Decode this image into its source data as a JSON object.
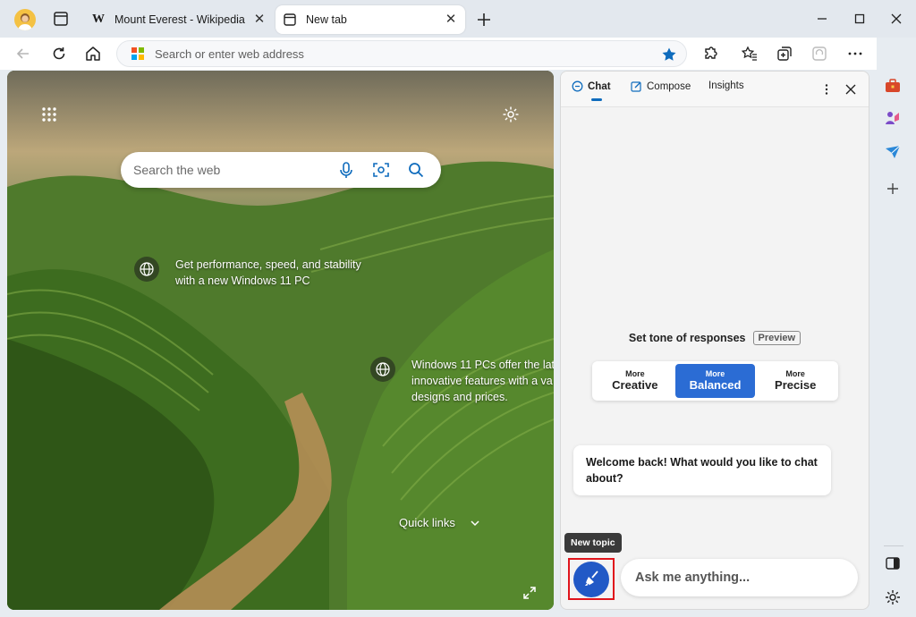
{
  "tabs": [
    {
      "title": "Mount Everest - Wikipedia",
      "favicon": "W"
    },
    {
      "title": "New tab"
    }
  ],
  "address_bar": {
    "placeholder": "Search or enter web address"
  },
  "ntp": {
    "search_placeholder": "Search the web",
    "info_cards": [
      {
        "line1": "Get performance, speed, and stability",
        "line2": "with a new Windows 11 PC"
      },
      {
        "line1": "Windows 11 PCs offer the lat",
        "line2": "innovative features with a va",
        "line3": "designs and prices."
      }
    ],
    "quick_links_label": "Quick links"
  },
  "chat_panel": {
    "tabs": [
      {
        "label": "Chat",
        "active": true
      },
      {
        "label": "Compose",
        "active": false
      },
      {
        "label": "Insights",
        "active": false
      }
    ],
    "tone_title": "Set tone of responses",
    "preview_badge": "Preview",
    "tones": [
      {
        "more": "More",
        "name": "Creative",
        "selected": false
      },
      {
        "more": "More",
        "name": "Balanced",
        "selected": true
      },
      {
        "more": "More",
        "name": "Precise",
        "selected": false
      }
    ],
    "welcome_message": "Welcome back! What would you like to chat about?",
    "new_topic_tooltip": "New topic",
    "input_placeholder": "Ask me anything..."
  },
  "colors": {
    "accent": "#2b6cd4",
    "highlight_border": "#e0141b"
  }
}
